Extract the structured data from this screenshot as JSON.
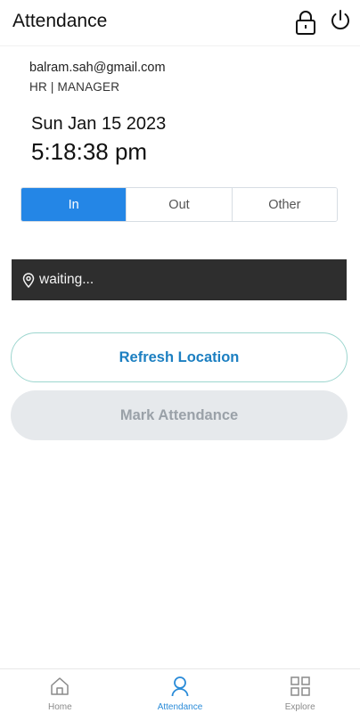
{
  "header": {
    "title": "Attendance",
    "icons": [
      "lock-icon",
      "power-icon"
    ]
  },
  "user": {
    "email": "balram.sah@gmail.com",
    "role": "HR | MANAGER"
  },
  "clock": {
    "date": "Sun Jan 15 2023",
    "time": "5:18:38 pm"
  },
  "segments": {
    "items": [
      {
        "label": "In",
        "selected": true
      },
      {
        "label": "Out",
        "selected": false
      },
      {
        "label": "Other",
        "selected": false
      }
    ]
  },
  "location": {
    "status": "waiting...",
    "icon": "location-pin-icon"
  },
  "actions": {
    "refresh_label": "Refresh Location",
    "mark_label": "Mark Attendance",
    "mark_disabled": true
  },
  "tabbar": {
    "items": [
      {
        "label": "Home",
        "icon": "home-icon",
        "active": false
      },
      {
        "label": "Attendance",
        "icon": "person-icon",
        "active": true
      },
      {
        "label": "Explore",
        "icon": "grid-icon",
        "active": false
      }
    ]
  },
  "colors": {
    "accent": "#2486e6",
    "status_bar": "#2e2e2e",
    "link_text": "#1c7fc1",
    "disabled_bg": "#e6e9ec",
    "tab_active": "#2a8bd8"
  }
}
